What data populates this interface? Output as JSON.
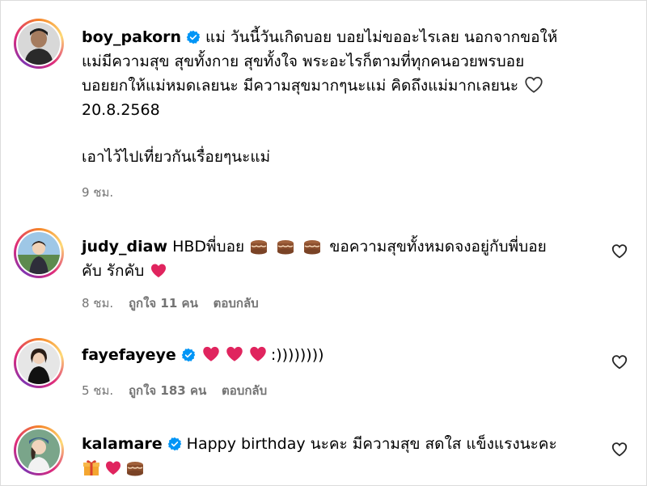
{
  "comments": [
    {
      "username": "boy_pakorn",
      "verified": true,
      "text_lines": [
        "แม่ วันนี้วันเกิดบอย บอยไม่ขออะไรเลย นอกจากขอให้",
        "แม่มีความสุข สุขทั้งกาย สุขทั้งใจ พระอะไรก็ตามที่ทุกคนอวยพรบอย",
        "บอยยกให้แม่หมดเลยนะ มีความสุขมากๆนะแม่ คิดถึงแม่มากเลยนะ",
        "20.8.2568",
        "เอาไว้ไปเที่ยวกันเรื่อยๆนะแม่"
      ],
      "time": "9 ชม."
    },
    {
      "username": "judy_diaw",
      "verified": false,
      "text_line1": "HBDพี่บอย",
      "text_line1_after": "ขอความสุขทั้งหมดจงอยู่กับพี่บอย",
      "text_line2": "คับ รักคับ",
      "time": "8 ชม.",
      "likes": "ถูกใจ 11 คน",
      "reply": "ตอบกลับ"
    },
    {
      "username": "fayefayeye",
      "verified": true,
      "text_after": ":))))))))",
      "time": "5 ชม.",
      "likes": "ถูกใจ 183 คน",
      "reply": "ตอบกลับ"
    },
    {
      "username": "kalamare",
      "verified": true,
      "text_line1": "Happy birthday นะคะ มีความสุข สดใส แข็งแรงนะคะ"
    }
  ],
  "colors": {
    "verified": "#0095f6",
    "heart_red": "#e0245e",
    "meta_gray": "#737373"
  },
  "icons": [
    "verified-badge-icon",
    "heart-outline-icon",
    "red-heart-emoji",
    "cake-emoji",
    "gift-emoji"
  ]
}
